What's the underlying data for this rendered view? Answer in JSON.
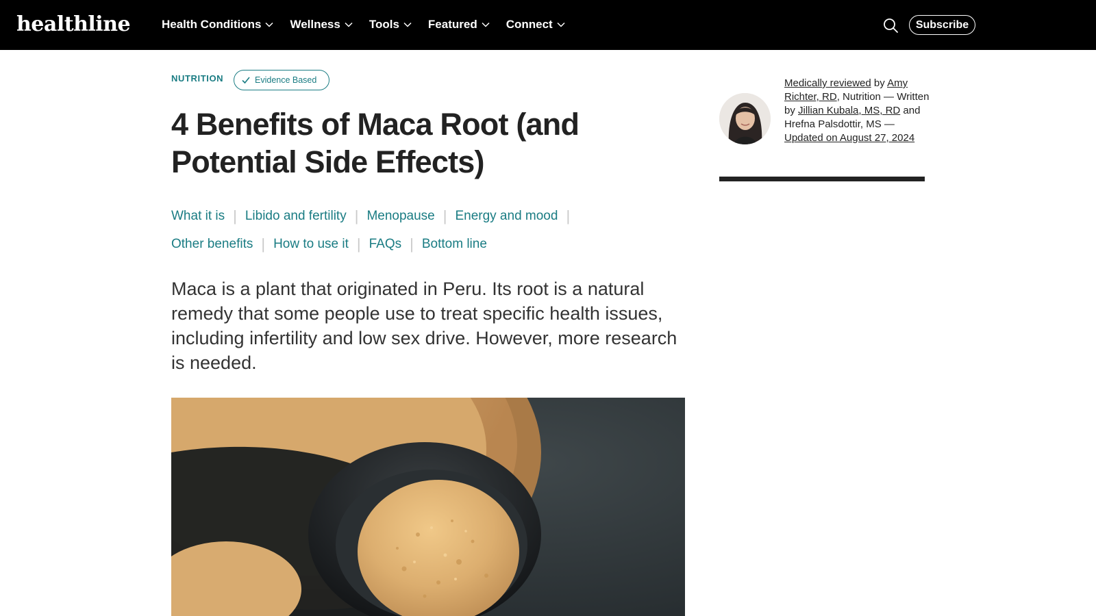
{
  "header": {
    "logo": "healthline",
    "nav": [
      {
        "label": "Health Conditions"
      },
      {
        "label": "Wellness"
      },
      {
        "label": "Tools"
      },
      {
        "label": "Featured"
      },
      {
        "label": "Connect"
      }
    ],
    "subscribe_label": "Subscribe"
  },
  "article": {
    "category": "NUTRITION",
    "badge": "Evidence Based",
    "title": "4 Benefits of Maca Root (and Potential Side Effects)",
    "toc_row1": [
      {
        "label": "What it is"
      },
      {
        "label": "Libido and fertility"
      },
      {
        "label": "Menopause"
      },
      {
        "label": "Energy and mood"
      }
    ],
    "toc_row2": [
      {
        "label": "Other benefits"
      },
      {
        "label": "How to use it"
      },
      {
        "label": "FAQs"
      },
      {
        "label": "Bottom line"
      }
    ],
    "intro": "Maca is a plant that originated in Peru. Its root is a natural remedy that some people use to treat specific health issues, including infertility and low sex drive. However, more research is needed.",
    "image_alt": "Maca powder in a wooden bowl and black spoon"
  },
  "byline": {
    "reviewed_link": "Medically reviewed",
    "by1": " by ",
    "reviewer": "Amy Richter, RD",
    "reviewer_suffix": ", Nutrition — Written by ",
    "writer": "Jillian Kubala, MS, RD",
    "writer_suffix": " and Hrefna Palsdottir, MS — ",
    "updated": "Updated on August 27, 2024"
  },
  "colors": {
    "accent": "#1a7c83",
    "header_bg": "#000000",
    "text": "#222222"
  }
}
